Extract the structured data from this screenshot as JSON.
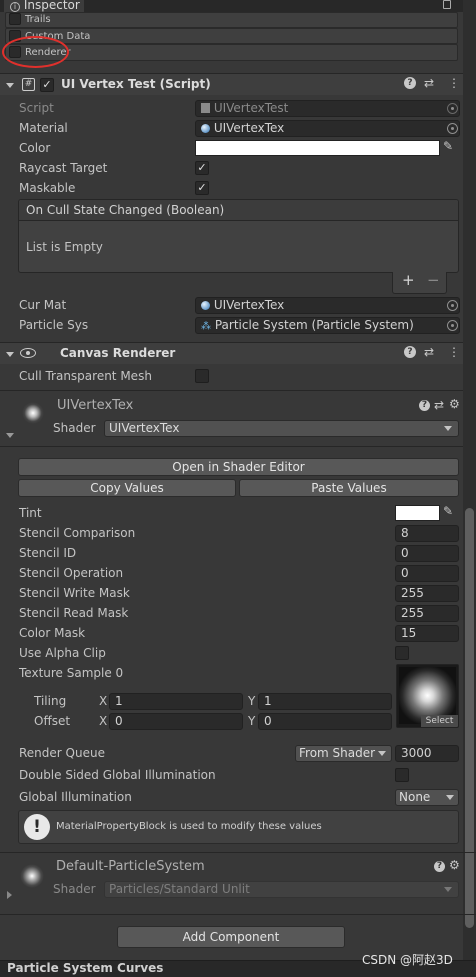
{
  "tab": {
    "title": "Inspector"
  },
  "hidden_modules": [
    {
      "label": "Trails"
    },
    {
      "label": "Custom Data"
    },
    {
      "label": "Renderer"
    }
  ],
  "script_component": {
    "title": "UI Vertex Test (Script)",
    "script_label": "Script",
    "script_value": "UIVertexTest",
    "material_label": "Material",
    "material_value": "UIVertexTex",
    "color_label": "Color",
    "raycast_label": "Raycast Target",
    "maskable_label": "Maskable",
    "event_title": "On Cull State Changed (Boolean)",
    "event_empty": "List is Empty",
    "plus": "+",
    "minus": "−",
    "curmat_label": "Cur Mat",
    "curmat_value": "UIVertexTex",
    "particle_label": "Particle Sys",
    "particle_value": "Particle System (Particle System)"
  },
  "canvas_renderer": {
    "title": "Canvas Renderer",
    "cull_label": "Cull Transparent Mesh"
  },
  "material": {
    "name": "UIVertexTex",
    "shader_label": "Shader",
    "shader_value": "UIVertexTex",
    "open_editor": "Open in Shader Editor",
    "copy_values": "Copy Values",
    "paste_values": "Paste Values",
    "props": [
      {
        "label": "Tint",
        "value": ""
      },
      {
        "label": "Stencil Comparison",
        "value": "8"
      },
      {
        "label": "Stencil ID",
        "value": "0"
      },
      {
        "label": "Stencil Operation",
        "value": "0"
      },
      {
        "label": "Stencil Write Mask",
        "value": "255"
      },
      {
        "label": "Stencil Read Mask",
        "value": "255"
      },
      {
        "label": "Color Mask",
        "value": "15"
      },
      {
        "label": "Use Alpha Clip",
        "value": ""
      },
      {
        "label": "Texture Sample 0",
        "value": ""
      }
    ],
    "tiling_label": "Tiling",
    "offset_label": "Offset",
    "x": "X",
    "y": "Y",
    "tiling_x": "1",
    "tiling_y": "1",
    "offset_x": "0",
    "offset_y": "0",
    "select": "Select",
    "render_queue_label": "Render Queue",
    "render_queue_mode": "From Shader",
    "render_queue_value": "3000",
    "dsgi_label": "Double Sided Global Illumination",
    "gi_label": "Global Illumination",
    "gi_value": "None",
    "info_text": "MaterialPropertyBlock is used to modify these values"
  },
  "default_material": {
    "name": "Default-ParticleSystem",
    "shader_label": "Shader",
    "shader_value": "Particles/Standard Unlit"
  },
  "add_component": "Add Component",
  "footer": {
    "title": "Particle System Curves"
  },
  "watermark": "CSDN @阿赵3D",
  "colors": {
    "accent_circle": "#e0302c",
    "panel": "#383838",
    "header": "#3e3e3e",
    "field": "#2a2a2a"
  }
}
